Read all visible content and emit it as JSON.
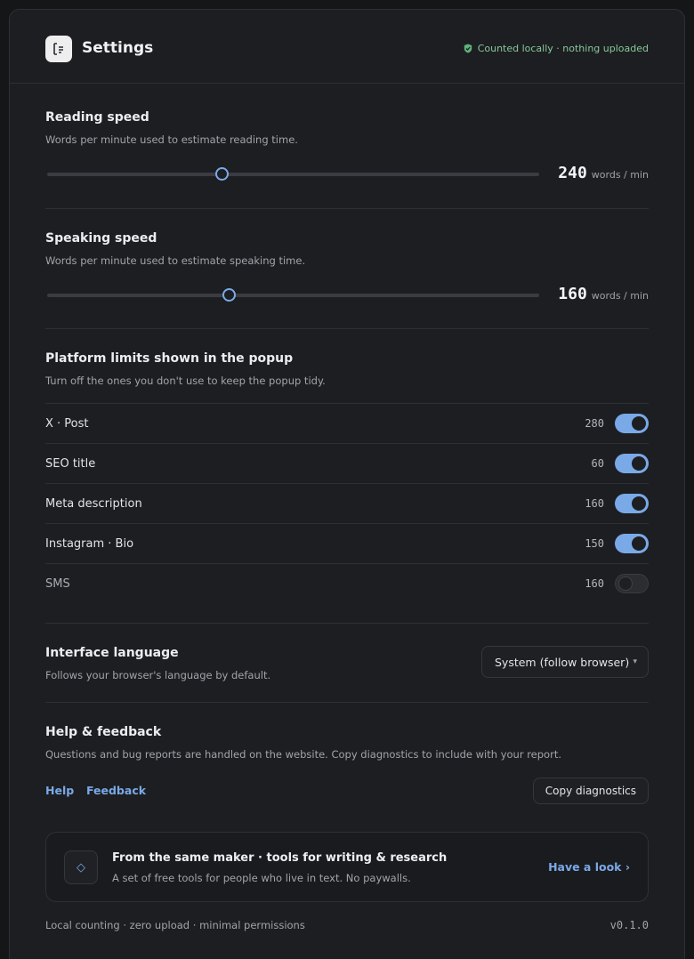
{
  "header": {
    "title": "Settings",
    "status": "Counted locally · nothing uploaded",
    "colors": {
      "accent": "#7aa9e8",
      "status": "#86c79a"
    }
  },
  "reading": {
    "title": "Reading speed",
    "desc": "Words per minute used to estimate reading time.",
    "value": "240",
    "unit": "words / min",
    "slider_fraction": 0.355
  },
  "speaking": {
    "title": "Speaking speed",
    "desc": "Words per minute used to estimate speaking time.",
    "value": "160",
    "unit": "words / min",
    "slider_fraction": 0.369
  },
  "platforms": {
    "title": "Platform limits shown in the popup",
    "desc": "Turn off the ones you don't use to keep the popup tidy.",
    "items": [
      {
        "label": "X · Post",
        "limit": "280",
        "enabled": true
      },
      {
        "label": "SEO title",
        "limit": "60",
        "enabled": true
      },
      {
        "label": "Meta description",
        "limit": "160",
        "enabled": true
      },
      {
        "label": "Instagram · Bio",
        "limit": "150",
        "enabled": true
      },
      {
        "label": "SMS",
        "limit": "160",
        "enabled": false
      }
    ]
  },
  "language": {
    "title": "Interface language",
    "desc": "Follows your browser's language by default.",
    "selected": "System (follow browser)"
  },
  "help": {
    "title": "Help & feedback",
    "desc": "Questions and bug reports are handled on the website. Copy diagnostics to include with your report.",
    "help_link": "Help",
    "feedback_link": "Feedback",
    "copy_button": "Copy diagnostics"
  },
  "promo": {
    "icon": "diamond-icon",
    "title": "From the same maker · tools for writing & research",
    "desc": "A set of free tools for people who live in text. No paywalls.",
    "link": "Have a look ›"
  },
  "footer": {
    "left": "Local counting · zero upload · minimal permissions",
    "version": "v0.1.0"
  }
}
